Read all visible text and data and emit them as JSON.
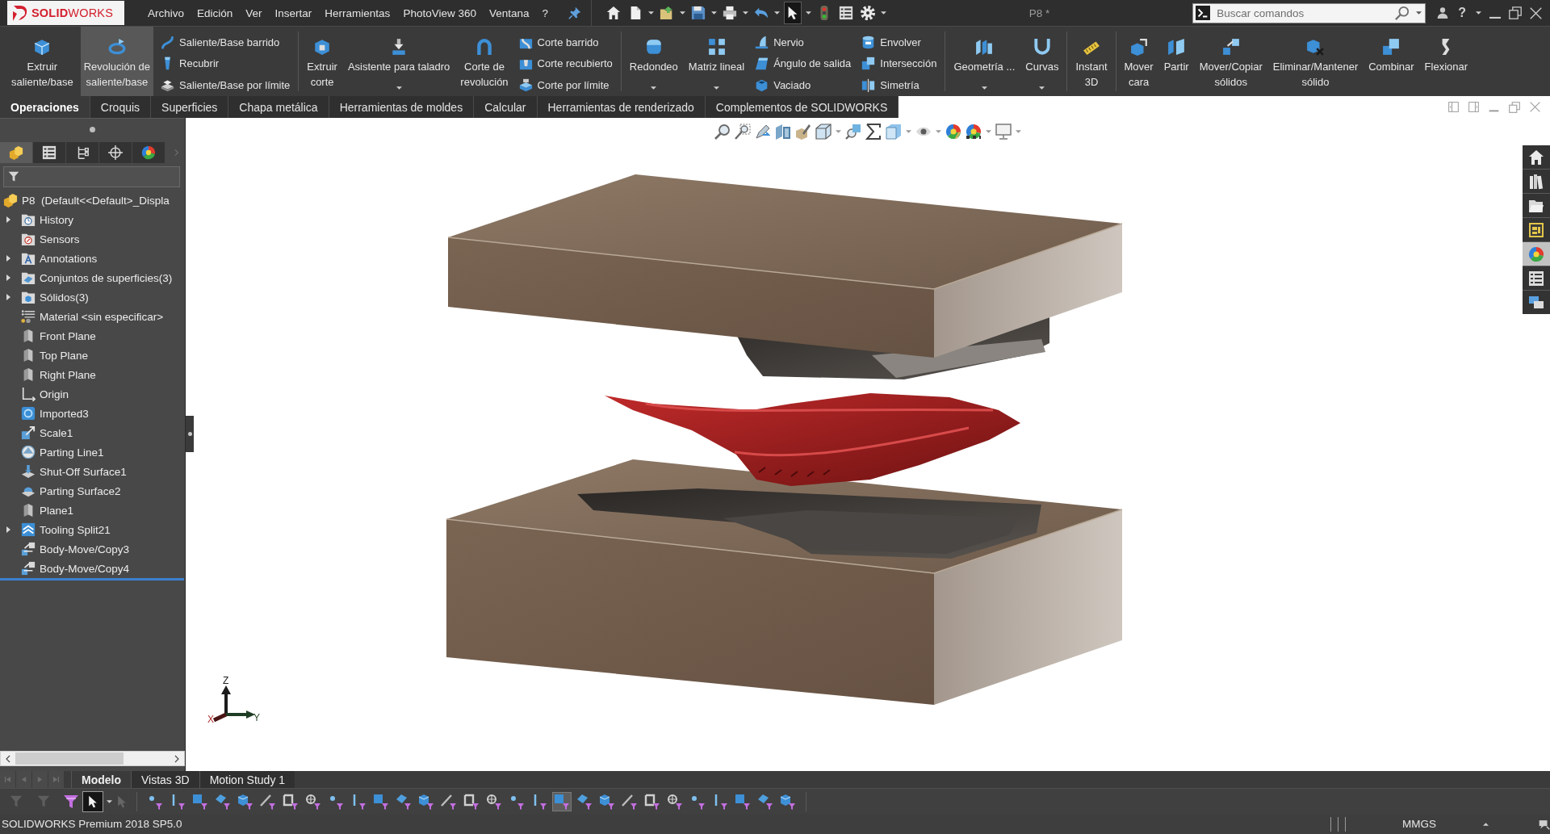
{
  "title_bar": {
    "logo": "**SOLID**WORKS",
    "menus": [
      "Archivo",
      "Edición",
      "Ver",
      "Insertar",
      "Herramientas",
      "PhotoView 360",
      "Ventana",
      "?"
    ],
    "quick_access": [
      {
        "kind": "home",
        "dropdown": false,
        "pressed": false
      },
      {
        "kind": "new",
        "dropdown": true,
        "pressed": false
      },
      {
        "kind": "open",
        "dropdown": true,
        "pressed": false
      },
      {
        "kind": "save",
        "dropdown": true,
        "pressed": false
      },
      {
        "kind": "print",
        "dropdown": true,
        "pressed": false
      },
      {
        "kind": "undo",
        "dropdown": true,
        "pressed": false
      },
      {
        "kind": "select",
        "dropdown": true,
        "pressed": true
      },
      {
        "kind": "rebuild",
        "dropdown": false,
        "pressed": false
      },
      {
        "kind": "properties",
        "dropdown": false,
        "pressed": false
      },
      {
        "kind": "options",
        "dropdown": true,
        "pressed": false
      }
    ],
    "document_title": "P8 *",
    "search": {
      "placeholder": "Buscar comandos"
    },
    "help": "?"
  },
  "command_manager": {
    "groups": [
      {
        "items": [
          {
            "kind": "large",
            "label": "Extruir\nsaliente/base",
            "dropdown": false,
            "highlighted": false
          },
          {
            "kind": "large",
            "label": "Revolución de\nsaliente/base",
            "dropdown": false,
            "highlighted": true
          },
          {
            "kind": "stack",
            "entries": [
              {
                "label": "Saliente/Base barrido"
              },
              {
                "label": "Recubrir"
              },
              {
                "label": "Saliente/Base por límite"
              }
            ]
          }
        ]
      },
      {
        "items": [
          {
            "kind": "large",
            "label": "Extruir\ncorte",
            "dropdown": false,
            "highlighted": false
          },
          {
            "kind": "large",
            "label": "Asistente para taladro",
            "dropdown": true,
            "highlighted": false
          },
          {
            "kind": "large",
            "label": "Corte de\nrevolución",
            "dropdown": false,
            "highlighted": false
          },
          {
            "kind": "stack",
            "entries": [
              {
                "label": "Corte barrido"
              },
              {
                "label": "Corte recubierto"
              },
              {
                "label": "Corte por límite"
              }
            ]
          }
        ]
      },
      {
        "items": [
          {
            "kind": "large",
            "label": "Redondeo",
            "dropdown": true,
            "highlighted": false
          },
          {
            "kind": "large",
            "label": "Matriz lineal",
            "dropdown": true,
            "highlighted": false
          },
          {
            "kind": "stack",
            "entries": [
              {
                "label": "Nervio"
              },
              {
                "label": "Ángulo de salida"
              },
              {
                "label": "Vaciado"
              }
            ]
          },
          {
            "kind": "stack",
            "entries": [
              {
                "label": "Envolver"
              },
              {
                "label": "Intersección"
              },
              {
                "label": "Simetría"
              }
            ]
          }
        ]
      },
      {
        "items": [
          {
            "kind": "large",
            "label": "Geometría ...",
            "dropdown": true,
            "highlighted": false
          },
          {
            "kind": "large",
            "label": "Curvas",
            "dropdown": true,
            "highlighted": false
          }
        ]
      },
      {
        "items": [
          {
            "kind": "large",
            "label": "Instant\n3D",
            "dropdown": false,
            "highlighted": false
          }
        ]
      },
      {
        "items": [
          {
            "kind": "large",
            "label": "Mover\ncara",
            "dropdown": false,
            "highlighted": false
          },
          {
            "kind": "large",
            "label": "Partir",
            "dropdown": false,
            "highlighted": false
          },
          {
            "kind": "large",
            "label": "Mover/Copiar\nsólidos",
            "dropdown": false,
            "highlighted": false
          },
          {
            "kind": "large",
            "label": "Eliminar/Mantener\nsólido",
            "dropdown": false,
            "highlighted": false
          },
          {
            "kind": "large",
            "label": "Combinar",
            "dropdown": false,
            "highlighted": false
          },
          {
            "kind": "large",
            "label": "Flexionar",
            "dropdown": false,
            "highlighted": false
          }
        ]
      }
    ]
  },
  "feature_tabs": [
    {
      "label": "Operaciones",
      "selected": true
    },
    {
      "label": "Croquis",
      "selected": false
    },
    {
      "label": "Superficies",
      "selected": false
    },
    {
      "label": "Chapa metálica",
      "selected": false
    },
    {
      "label": "Herramientas de moldes",
      "selected": false
    },
    {
      "label": "Calcular",
      "selected": false
    },
    {
      "label": "Herramientas de renderizado",
      "selected": false
    },
    {
      "label": "Complementos de SOLIDWORKS",
      "selected": false
    }
  ],
  "left_panel": {
    "manager_tabs": [
      {
        "kind": "feature",
        "selected": true
      },
      {
        "kind": "property",
        "selected": false
      },
      {
        "kind": "config",
        "selected": false
      },
      {
        "kind": "dimxpert",
        "selected": false
      },
      {
        "kind": "display",
        "selected": false
      }
    ]
  },
  "feature_tree": {
    "root": {
      "label": "P8  (Default<<Default>_Displa",
      "kind": "part",
      "children": [
        {
          "label": "History",
          "kind": "history",
          "has_children": true
        },
        {
          "label": "Sensors",
          "kind": "sensors",
          "has_children": false
        },
        {
          "label": "Annotations",
          "kind": "annotations",
          "has_children": true
        },
        {
          "label": "Conjuntos de superficies(3)",
          "kind": "surfaces",
          "has_children": true
        },
        {
          "label": "Sólidos(3)",
          "kind": "solids",
          "has_children": true
        },
        {
          "label": "Material <sin especificar>",
          "kind": "material",
          "has_children": false
        },
        {
          "label": "Front Plane",
          "kind": "plane",
          "has_children": false
        },
        {
          "label": "Top Plane",
          "kind": "plane",
          "has_children": false
        },
        {
          "label": "Right Plane",
          "kind": "plane",
          "has_children": false
        },
        {
          "label": "Origin",
          "kind": "origin",
          "has_children": false
        },
        {
          "label": "Imported3",
          "kind": "imported",
          "has_children": false
        },
        {
          "label": "Scale1",
          "kind": "scale",
          "has_children": false
        },
        {
          "label": "Parting Line1",
          "kind": "partingline",
          "has_children": false
        },
        {
          "label": "Shut-Off Surface1",
          "kind": "shutoff",
          "has_children": false
        },
        {
          "label": "Parting Surface2",
          "kind": "partingsurface",
          "has_children": false
        },
        {
          "label": "Plane1",
          "kind": "plane",
          "has_children": false
        },
        {
          "label": "Tooling Split21",
          "kind": "split",
          "has_children": true
        },
        {
          "label": "Body-Move/Copy3",
          "kind": "bodymove",
          "has_children": false
        },
        {
          "label": "Body-Move/Copy4",
          "kind": "bodymove",
          "has_children": false
        }
      ]
    }
  },
  "graphics": {
    "triad": {
      "labels": [
        "Z",
        "X",
        "Y"
      ]
    },
    "task_pane": [
      {
        "kind": "home",
        "selected": false
      },
      {
        "kind": "library",
        "selected": false
      },
      {
        "kind": "explorer",
        "selected": false
      },
      {
        "kind": "palette",
        "selected": false
      },
      {
        "kind": "appearances",
        "selected": true
      },
      {
        "kind": "properties",
        "selected": false
      },
      {
        "kind": "forum",
        "selected": false
      }
    ]
  },
  "model_tabs": {
    "nav_disabled": true,
    "tabs": [
      {
        "label": "Modelo",
        "selected": true
      },
      {
        "label": "Vistas 3D",
        "selected": false
      },
      {
        "label": "Motion Study 1",
        "selected": false
      }
    ]
  },
  "selection_toolbar": {
    "pointer_pressed": true,
    "filters": [
      {
        "pressed": false
      },
      {
        "pressed": false
      },
      {
        "pressed": false
      },
      {
        "pressed": false
      },
      {
        "pressed": false
      },
      {
        "pressed": false
      },
      {
        "pressed": false
      },
      {
        "pressed": false
      },
      {
        "pressed": false
      },
      {
        "pressed": false
      },
      {
        "pressed": false
      },
      {
        "pressed": false
      },
      {
        "pressed": false
      },
      {
        "pressed": false
      },
      {
        "pressed": false
      },
      {
        "pressed": false
      },
      {
        "pressed": false
      },
      {
        "pressed": false
      },
      {
        "pressed": true
      },
      {
        "pressed": false
      },
      {
        "pressed": false
      },
      {
        "pressed": false
      },
      {
        "pressed": false
      },
      {
        "pressed": false
      },
      {
        "pressed": false
      },
      {
        "pressed": false
      },
      {
        "pressed": false
      },
      {
        "pressed": false
      },
      {
        "pressed": false
      }
    ]
  },
  "status_bar": {
    "product": "SOLIDWORKS Premium 2018 SP5.0",
    "units": "MMGS"
  }
}
